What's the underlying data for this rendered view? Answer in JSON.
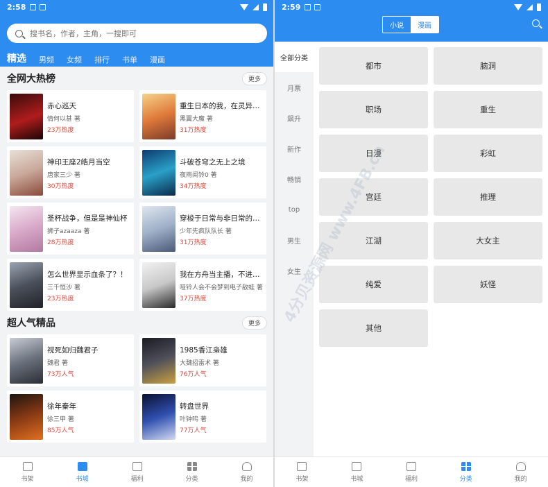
{
  "left": {
    "status_time": "2:58",
    "search_placeholder": "搜书名，作者，主角，一搜即可",
    "channels": [
      "精选",
      "男频",
      "女频",
      "排行",
      "书单",
      "漫画"
    ],
    "sections": [
      {
        "title": "全网大热榜",
        "more": "更多",
        "books": [
          {
            "title": "赤心巡天",
            "author": "情何以甚 著",
            "heat": "23万热度"
          },
          {
            "title": "重生日本的我，在灵异剧...",
            "author": "黑翼大魔 著",
            "heat": "31万热度"
          },
          {
            "title": "神印王座2皓月当空",
            "author": "唐家三少 著",
            "heat": "30万热度"
          },
          {
            "title": "斗破苍穹之无上之境",
            "author": "夜雨闻铃0 著",
            "heat": "34万热度"
          },
          {
            "title": "圣杯战争，但是是神仙杯",
            "author": "狮子azaaza 著",
            "heat": "28万热度"
          },
          {
            "title": "穿梭于日常与非日常的褪...",
            "author": "少年先疯队队长 著",
            "heat": "31万热度"
          },
          {
            "title": "怎么世界显示血条了？！",
            "author": "三千恒沙 著",
            "heat": "23万热度"
          },
          {
            "title": "我在方舟当主播，不进局...",
            "author": "哑铃人会不会梦到电子敌蛙 著",
            "heat": "37万热度"
          }
        ]
      },
      {
        "title": "超人气精品",
        "more": "更多",
        "books": [
          {
            "title": "视死如归魏君子",
            "author": "魏君 著",
            "heat": "73万人气"
          },
          {
            "title": "1985香江枭雄",
            "author": "大魏招雷术 著",
            "heat": "76万人气"
          },
          {
            "title": "徐年秦年",
            "author": "徐三甲 著",
            "heat": "85万人气"
          },
          {
            "title": "转盘世界",
            "author": "叶钟鸣 著",
            "heat": "77万人气"
          }
        ]
      }
    ],
    "nav": [
      "书架",
      "书城",
      "福利",
      "分类",
      "我的"
    ]
  },
  "right": {
    "status_time": "2:59",
    "segments": [
      "小说",
      "漫画"
    ],
    "categories": [
      "全部分类",
      "月票",
      "飙升",
      "新作",
      "畅销",
      "top",
      "男生",
      "女生"
    ],
    "tags": [
      "都市",
      "脑洞",
      "职场",
      "重生",
      "日漫",
      "彩虹",
      "宫廷",
      "推理",
      "江湖",
      "大女主",
      "纯爱",
      "妖怪",
      "其他"
    ],
    "nav": [
      "书架",
      "书城",
      "福利",
      "分类",
      "我的"
    ]
  },
  "watermark": "4分贝资源网 www.4FB.cn",
  "colors": {
    "primary": "#2d8cf0",
    "heat": "#e0483c"
  }
}
